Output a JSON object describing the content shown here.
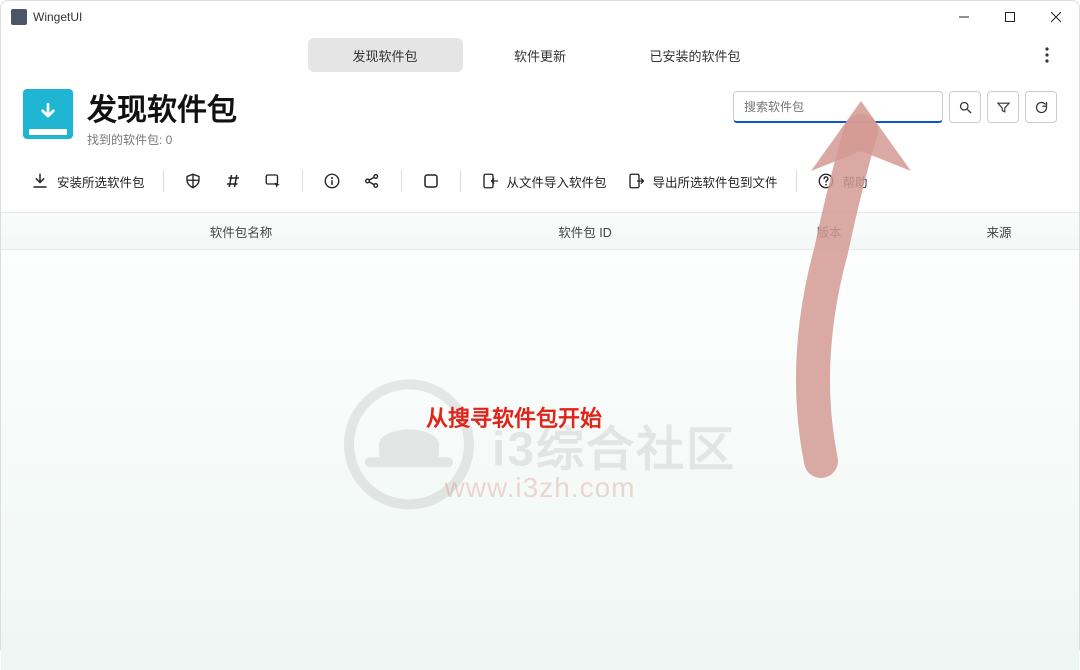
{
  "app": {
    "title": "WingetUI"
  },
  "tabs": {
    "discover": "发现软件包",
    "updates": "软件更新",
    "installed": "已安装的软件包"
  },
  "header": {
    "title": "发现软件包",
    "subtitle_prefix": "找到的软件包: ",
    "count": "0"
  },
  "search": {
    "placeholder": "搜索软件包"
  },
  "toolbar": {
    "install_selected": "安装所选软件包",
    "import_from_file": "从文件导入软件包",
    "export_to_file": "导出所选软件包到文件",
    "help": "帮助"
  },
  "table": {
    "col_name": "软件包名称",
    "col_id": "软件包 ID",
    "col_version": "版本",
    "col_source": "来源"
  },
  "watermark": {
    "text": "i3综合社区",
    "url": "www.i3zh.com"
  },
  "callout": {
    "text": "从搜寻软件包开始"
  }
}
